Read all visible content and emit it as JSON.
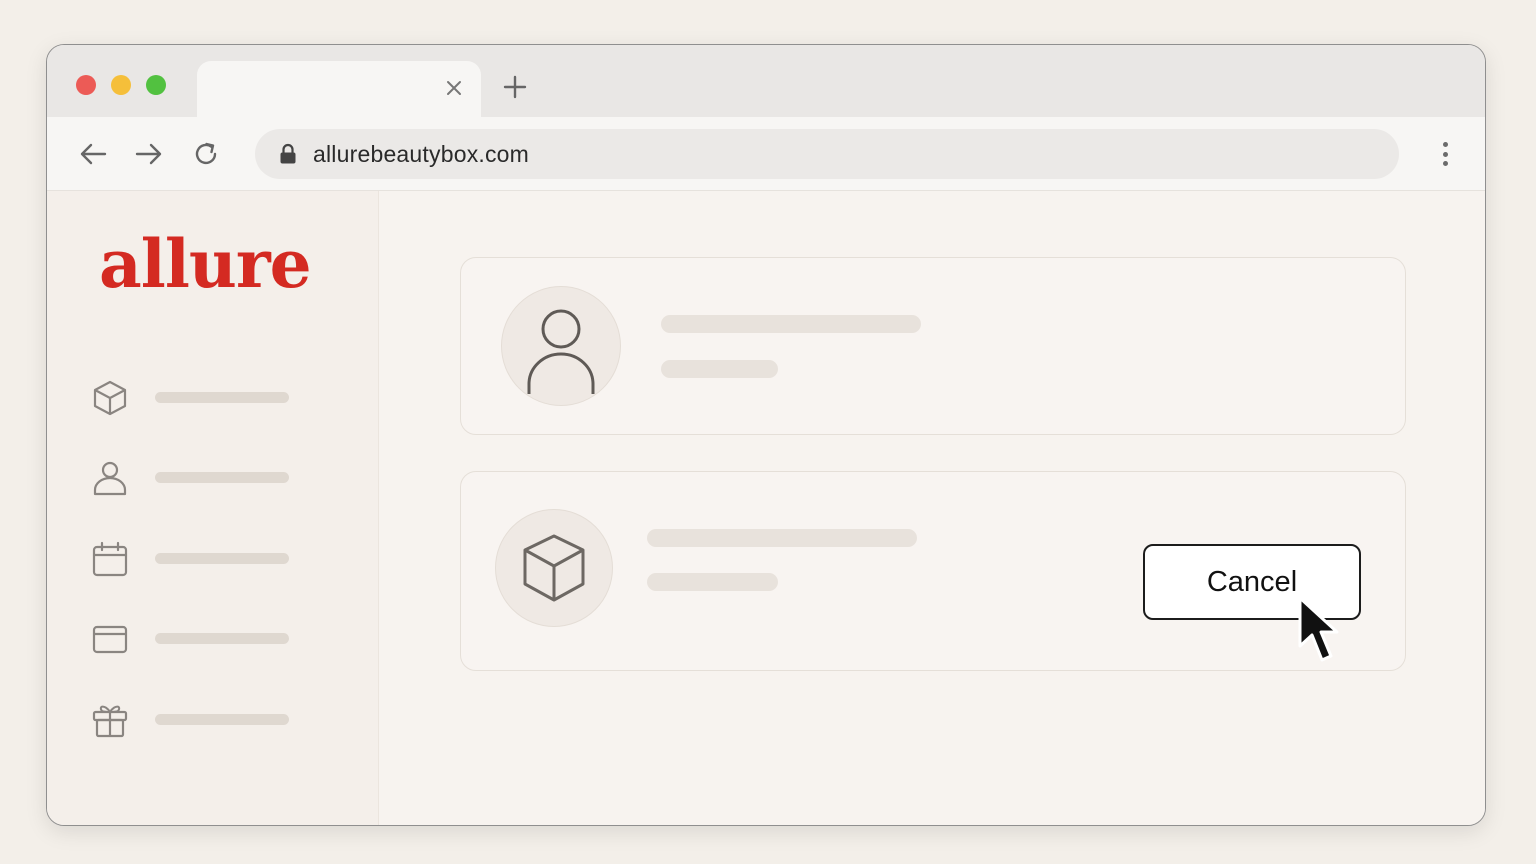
{
  "browser": {
    "url": "allurebeautybox.com",
    "tab": {
      "title": ""
    }
  },
  "sidebar": {
    "logo_text": "allure",
    "items": [
      {
        "icon": "box-icon"
      },
      {
        "icon": "user-icon"
      },
      {
        "icon": "calendar-icon"
      },
      {
        "icon": "credit-card-icon"
      },
      {
        "icon": "gift-icon"
      }
    ]
  },
  "main": {
    "profile_card": {
      "icon": "user-icon"
    },
    "subscription_card": {
      "icon": "box-icon",
      "cancel_label": "Cancel"
    }
  },
  "colors": {
    "brand": "#d42a22",
    "background": "#f3efe9",
    "window_bg": "#f7f3ef"
  }
}
